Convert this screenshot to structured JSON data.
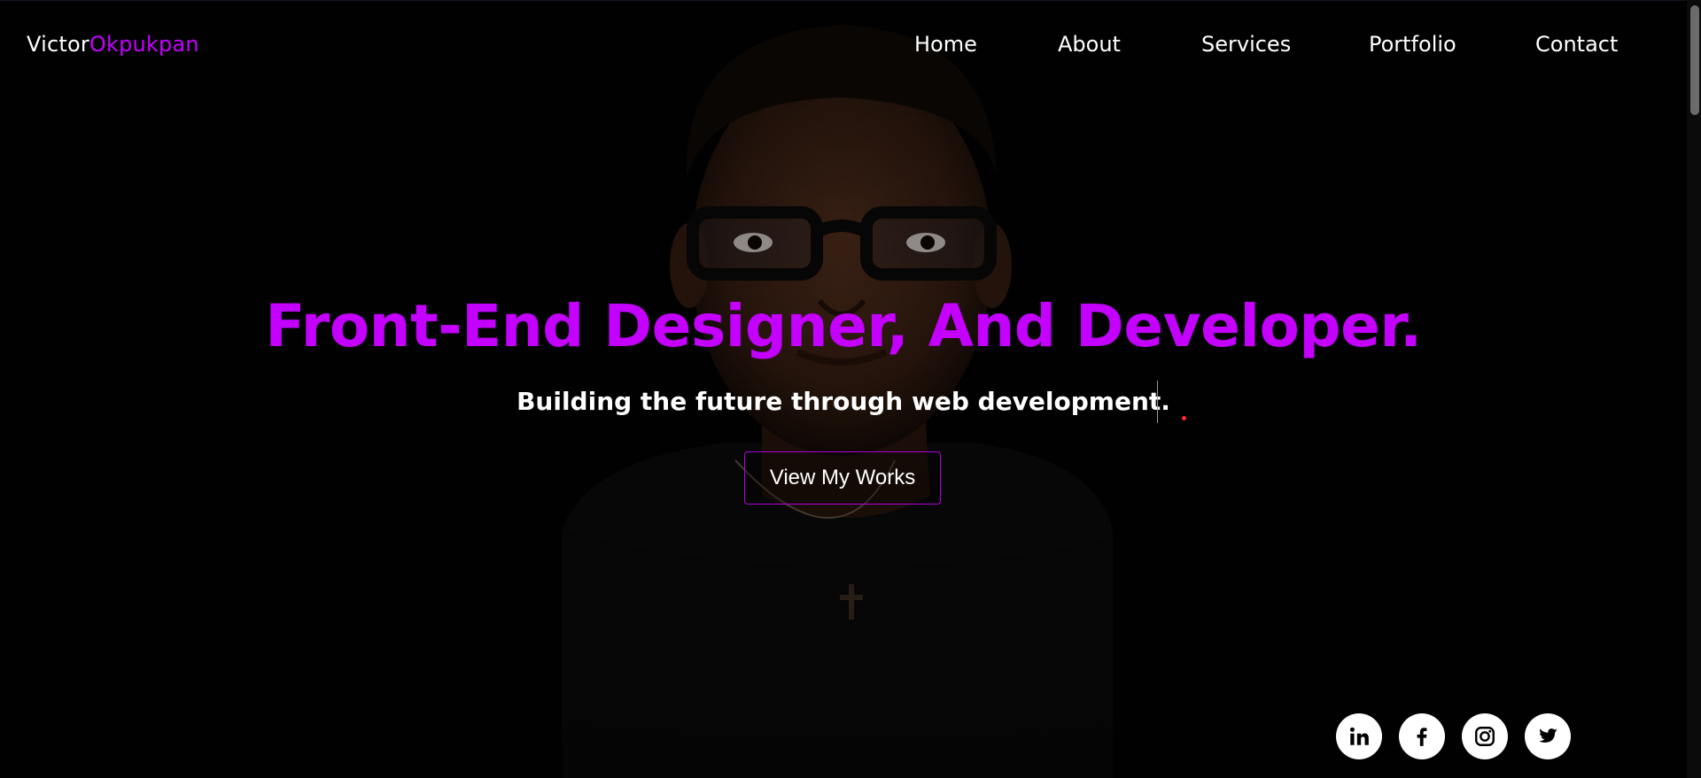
{
  "logo": {
    "first": "Victor",
    "last": "Okpukpan"
  },
  "nav": {
    "items": [
      "Home",
      "About",
      "Services",
      "Portfolio",
      "Contact"
    ]
  },
  "hero": {
    "headline": "Front-End Designer, And Developer.",
    "subline": "Building the future through web development.",
    "cta_label": "View My Works"
  },
  "social": {
    "icons": [
      "linkedin-icon",
      "facebook-icon",
      "instagram-icon",
      "twitter-icon"
    ]
  },
  "colors": {
    "accent": "#c400ff",
    "background": "#030303",
    "text": "#ffffff"
  }
}
